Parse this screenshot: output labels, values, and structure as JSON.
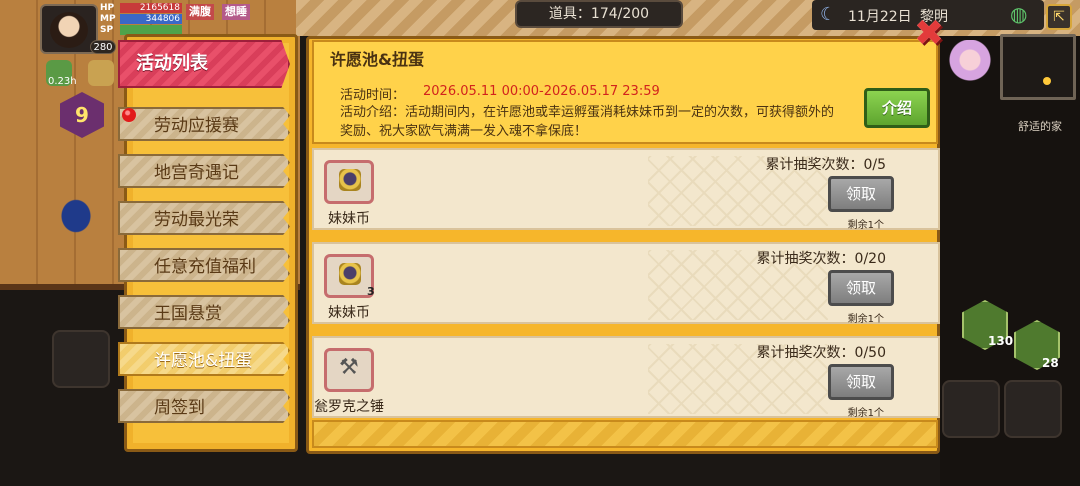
{
  "hud": {
    "hp_label": "HP",
    "hp_value": "2165618",
    "mp_label": "MP",
    "mp_value": "344806",
    "sp_label": "SP",
    "sp_value": "",
    "level": "280",
    "tag_full": "满腹",
    "tag_sleepy": "想睡",
    "cooldown": "0.23h",
    "dice_value": "9",
    "items_counter": "道具：174/200",
    "date": "11月22日",
    "time_of_day": "黎明",
    "home_label": "舒适的家",
    "stack_count_1": "130",
    "stack_count_2": "28"
  },
  "sidebar": {
    "header": "活动列表",
    "tabs": [
      {
        "label": "劳动应援赛"
      },
      {
        "label": "地宫奇遇记"
      },
      {
        "label": "劳动最光荣"
      },
      {
        "label": "任意充值福利"
      },
      {
        "label": "王国悬赏"
      },
      {
        "label": "许愿池&扭蛋"
      },
      {
        "label": "周签到"
      }
    ],
    "selected_index": 5
  },
  "event": {
    "title": "许愿池&扭蛋",
    "time_label": "活动时间：",
    "time_value": "2026.05.11 00:00-2026.05.17 23:59",
    "desc": "活动介绍：活动期间内，在许愿池或幸运孵蛋消耗妹妹币到一定的次数，可获得额外的奖励、祝大家欧气满满一发入魂不拿保底！",
    "intro_button": "介绍"
  },
  "rewards": [
    {
      "item_name": "妹妹币",
      "qty": "",
      "progress": "累计抽奖次数：0/5",
      "button": "领取",
      "remain": "剩余1个",
      "icon": "coin-icon"
    },
    {
      "item_name": "妹妹币",
      "qty": "3",
      "progress": "累计抽奖次数：0/20",
      "button": "领取",
      "remain": "剩余1个",
      "icon": "coin-icon"
    },
    {
      "item_name": "瓮罗克之锤",
      "qty": "",
      "progress": "累计抽奖次数：0/50",
      "button": "领取",
      "remain": "剩余1个",
      "icon": "hammer-icon"
    }
  ],
  "colors": {
    "panel": "#f6b62b",
    "selected_header": "#e9506a",
    "claim_disabled": "#8e8e8e",
    "intro_green": "#6fbf3b",
    "time_red": "#d2231d"
  }
}
